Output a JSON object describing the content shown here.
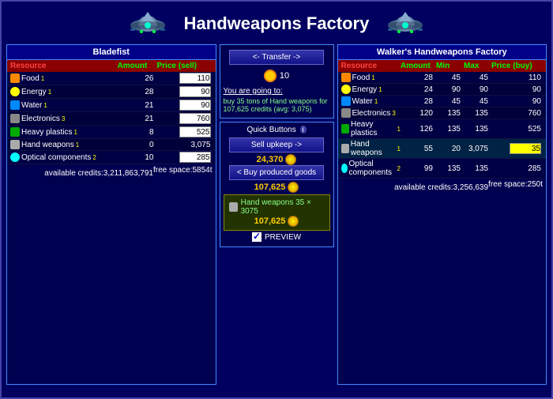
{
  "header": {
    "title": "Handweapons Factory"
  },
  "left_panel": {
    "title": "Bladefist",
    "columns": [
      "Resource",
      "Amount",
      "Price (sell)"
    ],
    "resources": [
      {
        "name": "Food",
        "sup": "1",
        "amount": 26,
        "price": 110,
        "icon": "food"
      },
      {
        "name": "Energy",
        "sup": "1",
        "amount": 28,
        "price": 90,
        "icon": "energy"
      },
      {
        "name": "Water",
        "sup": "1",
        "amount": 21,
        "price": 90,
        "icon": "water"
      },
      {
        "name": "Electronics",
        "sup": "3",
        "amount": 21,
        "price": 760,
        "icon": "electronics"
      },
      {
        "name": "Heavy plastics",
        "sup": "1",
        "amount": 8,
        "price": 525,
        "icon": "plastics"
      },
      {
        "name": "Hand weapons",
        "sup": "1",
        "amount": 0,
        "price_text": "3,075",
        "icon": "handweapons"
      },
      {
        "name": "Optical components",
        "sup": "2",
        "amount": 10,
        "price": 285,
        "icon": "optical"
      }
    ],
    "free_space_label": "free space:",
    "free_space_value": "5854t",
    "available_credits_label": "available credits:",
    "available_credits_value": "3,211,863,791"
  },
  "middle": {
    "transfer_button": "<- Transfer ->",
    "trade_amount": 10,
    "going_to_label": "You are going to:",
    "going_to_text": "buy 35 tons of Hand weapons for 107,625 credits (avg: 3,075)",
    "quick_buttons_label": "Quick Buttons",
    "quick_info": "i",
    "sell_upkeep_button": "Sell upkeep ->",
    "sell_amount": "24,370",
    "buy_goods_button": "< Buy produced goods",
    "buy_amount": "107,625",
    "tooltip": {
      "item": "Hand weapons 35 × 3075",
      "price": "107,625"
    },
    "preview_label": "PREVIEW"
  },
  "right_panel": {
    "title": "Walker's Handweapons Factory",
    "columns": [
      "Resource",
      "Amount",
      "Min",
      "Max",
      "Price (buy)"
    ],
    "resources": [
      {
        "name": "Food",
        "sup": "1",
        "amount": 28,
        "min": 45,
        "max": 45,
        "price": 110,
        "icon": "food"
      },
      {
        "name": "Energy",
        "sup": "1",
        "amount": 24,
        "min": 90,
        "max": 90,
        "price": 90,
        "icon": "energy"
      },
      {
        "name": "Water",
        "sup": "1",
        "amount": 28,
        "min": 45,
        "max": 45,
        "price": 90,
        "icon": "water"
      },
      {
        "name": "Electronics",
        "sup": "3",
        "amount": 120,
        "min": 135,
        "max": 135,
        "price": 760,
        "icon": "electronics"
      },
      {
        "name": "Heavy plastics",
        "sup": "1",
        "amount": 126,
        "min": 135,
        "max": 135,
        "price": 525,
        "icon": "plastics"
      },
      {
        "name": "Hand weapons",
        "sup": "1",
        "amount": 55,
        "min": 20,
        "max": "3,075",
        "price_input": "35",
        "icon": "handweapons",
        "highlight": true
      },
      {
        "name": "Optical components",
        "sup": "2",
        "amount": 99,
        "min": 135,
        "max": 135,
        "price": 285,
        "icon": "optical"
      }
    ],
    "free_space_label": "free space:",
    "free_space_value": "250t",
    "available_credits_label": "available credits:",
    "available_credits_value": "3,256,639"
  }
}
